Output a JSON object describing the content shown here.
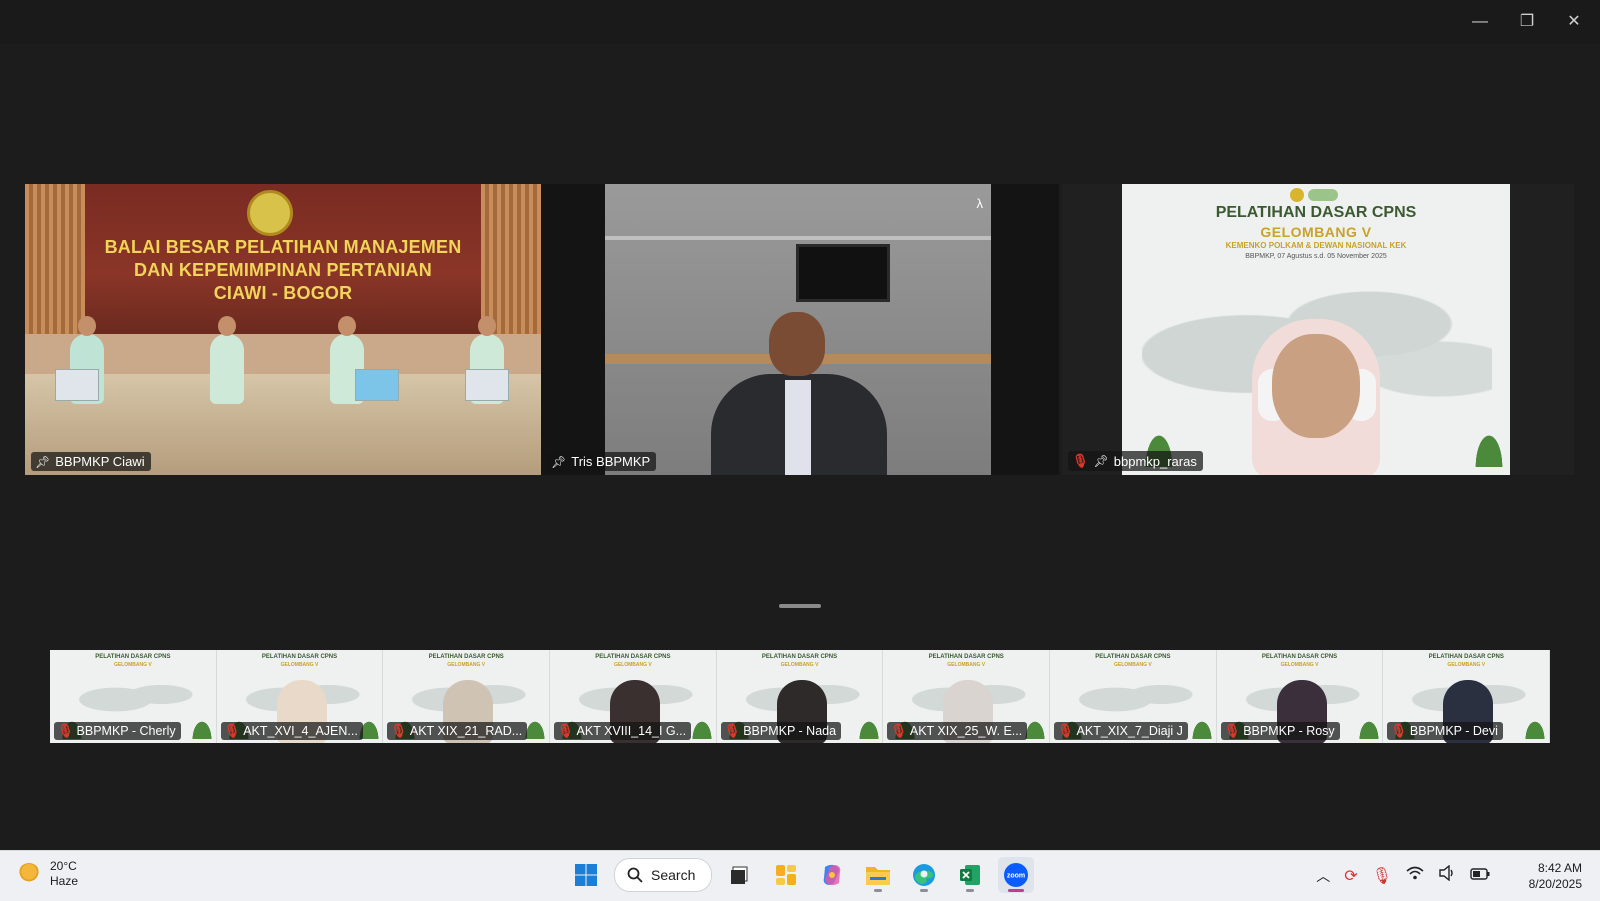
{
  "window": {
    "controls": {
      "minimize": "—",
      "restore": "❐",
      "close": "✕"
    }
  },
  "gallery": {
    "tiles": [
      {
        "name": "BBPMKP Ciawi",
        "sign_line1": "BALAI BESAR PELATIHAN MANAJEMEN",
        "sign_line2": "DAN KEPEMIMPINAN PERTANIAN",
        "sign_line3": "CIAWI - BOGOR",
        "pinned": true,
        "muted": false
      },
      {
        "name": "Tris BBPMKP",
        "pinned": true,
        "muted": false,
        "active_speaker": true,
        "badge": "λ"
      },
      {
        "name": "bbpmkp_raras",
        "pinned": true,
        "muted": true,
        "slide_title": "PELATIHAN DASAR CPNS",
        "slide_subtitle": "GELOMBANG V",
        "slide_line2": "KEMENKO POLKAM & DEWAN NASIONAL KEK",
        "slide_line3": "BBPMKP, 07 Agustus s.d. 05 November 2025"
      }
    ]
  },
  "filmstrip": {
    "participants": [
      {
        "name": "BBPMKP - Cherly",
        "muted": true,
        "face": ""
      },
      {
        "name": "AKT_XVI_4_AJEN...",
        "muted": true,
        "face": "#e8d9c9"
      },
      {
        "name": "AKT XIX_21_RAD...",
        "muted": true,
        "face": "#cfc3b3"
      },
      {
        "name": "AKT XVIII_14_I G...",
        "muted": true,
        "face": "#3a3030"
      },
      {
        "name": "BBPMKP - Nada",
        "muted": true,
        "face": "#2e2a2a"
      },
      {
        "name": "AKT XIX_25_W. E...",
        "muted": true,
        "face": "#d9d4cf"
      },
      {
        "name": "AKT_XIX_7_Diaji J",
        "muted": true,
        "face": ""
      },
      {
        "name": "BBPMKP - Rosy",
        "muted": true,
        "face": "#3a2f3a"
      },
      {
        "name": "BBPMKP - Devi",
        "muted": true,
        "face": "#2a3040"
      }
    ],
    "thumb_title": "PELATIHAN DASAR CPNS",
    "thumb_subtitle": "GELOMBANG V"
  },
  "taskbar": {
    "weather": {
      "temp": "20°C",
      "condition": "Haze",
      "icon": "haze-sun-icon"
    },
    "search_label": "Search",
    "apps": [
      {
        "name": "start-button",
        "icon": "windows-logo-icon"
      },
      {
        "name": "search-button",
        "icon": "search-icon"
      },
      {
        "name": "task-view-button",
        "icon": "task-view-icon"
      },
      {
        "name": "widgets-button",
        "icon": "widgets-icon"
      },
      {
        "name": "copilot-button",
        "icon": "copilot-icon"
      },
      {
        "name": "file-explorer-button",
        "icon": "folder-icon"
      },
      {
        "name": "edge-button",
        "icon": "edge-icon"
      },
      {
        "name": "excel-button",
        "icon": "excel-icon"
      },
      {
        "name": "zoom-button",
        "icon": "zoom-icon",
        "label": "zoom"
      }
    ],
    "clock": {
      "time": "8:42 AM",
      "date": "8/20/2025"
    }
  },
  "colors": {
    "active_speaker_border": "#23d160",
    "muted_mic": "#e0362b",
    "background": "#1c1c1c"
  }
}
